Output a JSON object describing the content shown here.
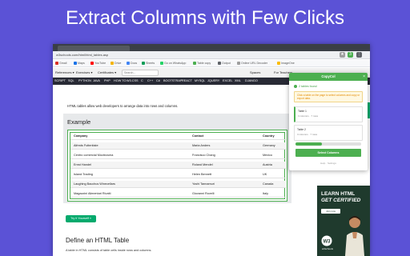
{
  "headline": "Extract Columns with Few Clicks",
  "browser": {
    "url": "w3schools.com/html/html_tables.asp",
    "ext_badge": "3"
  },
  "bookmarks": [
    {
      "label": "Gmail",
      "color": "#d93025"
    },
    {
      "label": "Maps",
      "color": "#1a73e8"
    },
    {
      "label": "YouTube",
      "color": "#ff0000"
    },
    {
      "label": "Drive",
      "color": "#f4b400"
    },
    {
      "label": "Docs",
      "color": "#4285f4"
    },
    {
      "label": "Sheets",
      "color": "#0f9d58"
    },
    {
      "label": "Go on WhatsApp",
      "color": "#25d366"
    },
    {
      "label": "Table copy",
      "color": "#4caf50"
    },
    {
      "label": "Output",
      "color": "#5f6368"
    },
    {
      "label": "Online URL Decoder",
      "color": "#9e9e9e"
    },
    {
      "label": "ImageOne",
      "color": "#fbbc05"
    }
  ],
  "nav": {
    "items": [
      "References ▾",
      "Exercises ▾",
      "Certificates ▾"
    ],
    "search_placeholder": "Search...",
    "right_items": [
      "Spaces",
      "For Teachers"
    ]
  },
  "topics": [
    "SCRIPT",
    "SQL",
    "PYTHON",
    "JAVA",
    "PHP",
    "HOW TO",
    "W3.CSS",
    "C",
    "C++",
    "C#",
    "BOOTSTRAP",
    "REACT",
    "MYSQL",
    "JQUERY",
    "EXCEL",
    "XML",
    "DJANGO"
  ],
  "content": {
    "intro": "HTML tables allow web developers to arrange data into rows and columns.",
    "example_title": "Example",
    "table": {
      "headers": [
        "Company",
        "Contact",
        "Country"
      ],
      "rows": [
        [
          "Alfreds Futterkiste",
          "Maria Anders",
          "Germany"
        ],
        [
          "Centro comercial Moctezuma",
          "Francisco Chang",
          "Mexico"
        ],
        [
          "Ernst Handel",
          "Roland Mendel",
          "Austria"
        ],
        [
          "Island Trading",
          "Helen Bennett",
          "UK"
        ],
        [
          "Laughing Bacchus Winecellars",
          "Yoshi Tannamuri",
          "Canada"
        ],
        [
          "Magazzini Alimentari Riuniti",
          "Giovanni Rovelli",
          "Italy"
        ]
      ]
    },
    "try_button": "Try it Yourself »",
    "define_title": "Define an HTML Table",
    "define_text": "A table in HTML consists of table cells inside rows and columns."
  },
  "ad": {
    "line1": "LEARN HTML",
    "line2": "GET CERTIFIED",
    "button": "Join now",
    "logo_text": "w3schools"
  },
  "popup": {
    "title": "CopyCol",
    "close": "×",
    "found": "2 tables found",
    "notice": "Click a table on the page to select columns and copy or export data.",
    "tables": [
      {
        "title": "Table 1",
        "subtitle": "3 columns · 7 rows"
      },
      {
        "title": "Table 2",
        "subtitle": "3 columns · 7 rows"
      }
    ],
    "slider_fraction": 0.4,
    "select_button": "Select Columns",
    "footer": "Help · Settings"
  },
  "colors": {
    "background": "#5b52d6",
    "accent": "#4caf50",
    "w3_green": "#04aa6d",
    "topic_bar": "#282a35"
  }
}
